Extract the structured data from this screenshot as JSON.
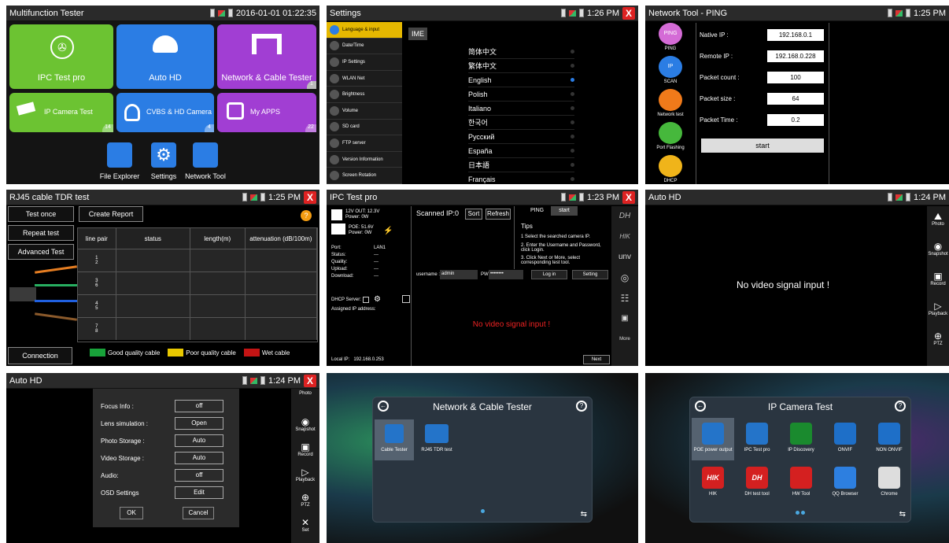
{
  "p1": {
    "title": "Multifunction Tester",
    "datetime": "2016-01-01 01:22:35",
    "tiles": [
      {
        "label": "IPC Test pro",
        "color": "#6cc332",
        "icon": "camera-icon"
      },
      {
        "label": "Auto HD",
        "color": "#2b7de4",
        "icon": "dome-camera-icon"
      },
      {
        "label": "Network & Cable Tester",
        "color": "#a13ed3",
        "icon": "network-ports-icon",
        "badge": "1"
      },
      {
        "label": "IP Camera Test",
        "color": "#6cc332",
        "icon": "ip-camera-icon",
        "badge": "14"
      },
      {
        "label": "CVBS & HD Camera",
        "color": "#2b7de4",
        "icon": "hd-camera-icon",
        "badge": "4"
      },
      {
        "label": "My APPS",
        "color": "#a13ed3",
        "icon": "apps-icon",
        "badge": "22"
      }
    ],
    "dock": [
      {
        "label": "File Explorer",
        "icon": "folder-icon"
      },
      {
        "label": "Settings",
        "icon": "gear-icon"
      },
      {
        "label": "Network Tool",
        "icon": "network-icon"
      }
    ]
  },
  "p2": {
    "title": "Settings",
    "time": "1:26 PM",
    "menu": [
      "Language & input",
      "Date/Time",
      "IP Settings",
      "WLAN Net",
      "Brightness",
      "Volume",
      "SD card",
      "FTP server",
      "Version Information",
      "Screen Rotation"
    ],
    "ime": "IME",
    "languages": [
      "简体中文",
      "繁体中文",
      "English",
      "Polish",
      "Italiano",
      "한국어",
      "Русский",
      "España",
      "日本語",
      "Français"
    ],
    "selected": "English"
  },
  "p3": {
    "title": "Network Tool - PING",
    "time": "1:25 PM",
    "tools": [
      {
        "label": "PING",
        "icon": "ping-icon",
        "sub": "PING"
      },
      {
        "label": "SCAN",
        "icon": "ip-scan-icon",
        "sub": "IP"
      },
      {
        "label": "Network test",
        "icon": "network-test-icon",
        "sub": ""
      },
      {
        "label": "Port Flashing",
        "icon": "port-flashing-icon",
        "sub": ""
      },
      {
        "label": "DHCP",
        "icon": "dhcp-icon",
        "sub": ""
      }
    ],
    "fields": [
      {
        "label": "Native IP :",
        "value": "192.168.0.1"
      },
      {
        "label": "Remote IP :",
        "value": "192.168.0.228"
      },
      {
        "label": "Packet count :",
        "value": "100"
      },
      {
        "label": "Packet size :",
        "value": "64"
      },
      {
        "label": "Packet Time :",
        "value": "0.2"
      }
    ],
    "start": "start"
  },
  "p4": {
    "title": "RJ45 cable TDR test",
    "time": "1:25 PM",
    "buttons": [
      "Test once",
      "Repeat test",
      "Advanced Test"
    ],
    "create": "Create Report",
    "headers": [
      "line pair",
      "status",
      "length(m)",
      "attenuation (dB/100m)"
    ],
    "pairs": [
      "1\n2",
      "3\n6",
      "4\n5",
      "7\n8"
    ],
    "conn": "Connection diagram",
    "legend": [
      {
        "label": "Good quality cable",
        "color": "#18a33a"
      },
      {
        "label": "Poor quality cable",
        "color": "#e8c800"
      },
      {
        "label": "Wet cable",
        "color": "#c41414"
      }
    ]
  },
  "p5": {
    "title": "IPC Test pro",
    "time": "1:23 PM",
    "v12": "12V OUT: 12.3V",
    "power1": "Power: 0W",
    "poe": "POE: 51.6V",
    "power2": "Power: 0W",
    "info": [
      [
        "Port:",
        "LAN1"
      ],
      [
        "Status:",
        "---"
      ],
      [
        "Quality:",
        "---"
      ],
      [
        "Upload:",
        "---"
      ],
      [
        "Download:",
        "---"
      ]
    ],
    "dhcp": "DHCP Server:",
    "assigned": "Assigned IP address:",
    "localip": "Local IP:   192.168.0.253",
    "scanned": "Scanned IP:0",
    "sort": "Sort",
    "refresh": "Refresh",
    "ping": "PING",
    "start": "start",
    "tips": "Tips",
    "tip1": "1 Select the searched camera IP.",
    "tip2": "2. Enter the Username and Password, click Login.",
    "tip3": "3. Click Next or More, select corresponding test tool.",
    "username_label": "username :",
    "username": "admin",
    "pw_label": "PW",
    "pw": "••••••••",
    "login": "Log in",
    "setting": "Setting",
    "novideo": "No video signal input !",
    "next": "Next",
    "brands": [
      "DH",
      "HIK",
      "unv"
    ],
    "more": "More"
  },
  "p6": {
    "title": "Auto HD",
    "time": "1:24 PM",
    "novideo": "No video signal input  !",
    "side": [
      "Photo",
      "Snapshot",
      "Record",
      "Playback",
      "PTZ"
    ]
  },
  "p7": {
    "title": "Auto HD",
    "time": "1:24 PM",
    "rows": [
      [
        "Focus Info :",
        "off"
      ],
      [
        "Lens simulation :",
        "Open"
      ],
      [
        "Photo Storage :",
        "Auto"
      ],
      [
        "Video Storage :",
        "Auto"
      ],
      [
        "Audio:",
        "off"
      ],
      [
        "OSD Settings",
        "Edit"
      ]
    ],
    "ok": "OK",
    "cancel": "Cancel",
    "side": [
      "Photo",
      "Snapshot",
      "Record",
      "Playback",
      "PTZ",
      "Set"
    ]
  },
  "p8": {
    "title": "Network & Cable Tester",
    "apps": [
      {
        "label": "Cable Tester",
        "icon": "cable-tester-icon"
      },
      {
        "label": "RJ45 TDR test",
        "icon": "rj45-tdr-icon"
      }
    ]
  },
  "p9": {
    "title": "IP Camera Test",
    "apps": [
      {
        "label": "POE power output",
        "icon": "poe-icon",
        "color": "#2474c9"
      },
      {
        "label": "IPC Test pro",
        "icon": "ipc-test-icon",
        "color": "#2474c9"
      },
      {
        "label": "IP Discovery",
        "icon": "ip-discovery-icon",
        "color": "#1a8a2e"
      },
      {
        "label": "ONVIF",
        "icon": "onvif-icon",
        "color": "#1e6fc8"
      },
      {
        "label": "NON ONVIF",
        "icon": "non-onvif-icon",
        "color": "#1e6fc8"
      },
      {
        "label": "HIK",
        "icon": "hik-icon",
        "color": "#d42020",
        "text": "HIK"
      },
      {
        "label": "DH test tool",
        "icon": "dh-icon",
        "color": "#d42020",
        "text": "DH"
      },
      {
        "label": "HW Tool",
        "icon": "hw-icon",
        "color": "#d42020"
      },
      {
        "label": "QQ Browser",
        "icon": "qq-browser-icon",
        "color": "#2d7fe0"
      },
      {
        "label": "Chrome",
        "icon": "chrome-icon",
        "color": "#ddd"
      }
    ]
  }
}
